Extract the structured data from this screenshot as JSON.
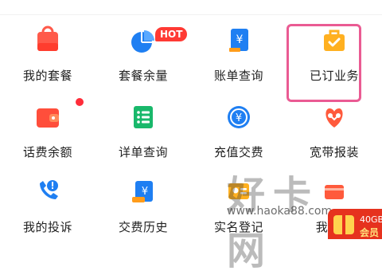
{
  "services": [
    {
      "label": "我的套餐",
      "icon": "shopping-bag-icon"
    },
    {
      "label": "套餐余量",
      "icon": "pie-chart-icon",
      "badge": "HOT"
    },
    {
      "label": "账单查询",
      "icon": "bill-yen-icon"
    },
    {
      "label": "已订业务",
      "icon": "briefcase-check-icon"
    },
    {
      "label": "话费余额",
      "icon": "wallet-icon",
      "dot": true
    },
    {
      "label": "详单查询",
      "icon": "list-icon"
    },
    {
      "label": "充值交费",
      "icon": "yen-circle-icon"
    },
    {
      "label": "宽带报装",
      "icon": "broadband-icon"
    },
    {
      "label": "我的投诉",
      "icon": "phone-alert-icon"
    },
    {
      "label": "交费历史",
      "icon": "payment-history-icon"
    },
    {
      "label": "实名登记",
      "icon": "id-card-icon"
    },
    {
      "label": "我的卡",
      "icon": "card-icon"
    }
  ],
  "watermark": {
    "logo": "好卡网",
    "url": "www.haoka88.com"
  },
  "promo": {
    "top": "40GB",
    "bottom": "会员"
  },
  "colors": {
    "accent": "#ff3a34",
    "highlight": "#ea5b93",
    "text": "#222222"
  }
}
